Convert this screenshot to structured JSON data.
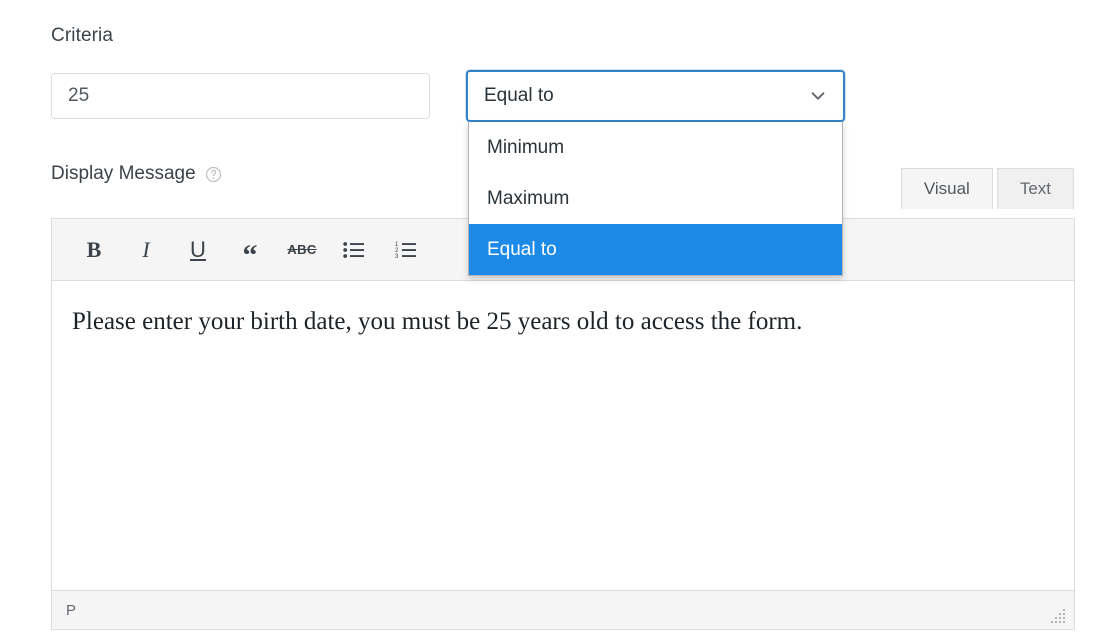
{
  "form": {
    "criteria": {
      "label": "Criteria",
      "value": "25",
      "placeholder": ""
    },
    "comparison_select": {
      "selected": "Equal to",
      "expanded": true,
      "chevron_icon": "chevron-down-icon",
      "options": [
        "Minimum",
        "Maximum",
        "Equal to"
      ]
    },
    "display_message": {
      "label": "Display Message",
      "help_icon": "question-circle-icon"
    }
  },
  "editor": {
    "tabs": [
      {
        "label": "Visual",
        "active": true
      },
      {
        "label": "Text",
        "active": false
      }
    ],
    "toolbar": [
      {
        "name": "bold-icon",
        "glyph": "B",
        "title": "Bold"
      },
      {
        "name": "italic-icon",
        "glyph": "I",
        "title": "Italic"
      },
      {
        "name": "underline-icon",
        "glyph": "U",
        "title": "Underline"
      },
      {
        "name": "blockquote-icon",
        "glyph": "“",
        "title": "Blockquote"
      },
      {
        "name": "strikethrough-icon",
        "glyph": "ABC",
        "title": "Strikethrough"
      },
      {
        "name": "unordered-list-icon",
        "glyph": "",
        "title": "Bulleted list"
      },
      {
        "name": "ordered-list-icon",
        "glyph": "",
        "title": "Numbered list"
      }
    ],
    "content": "Please enter your birth date, you must be 25 years old to access the form.",
    "status_path": "P",
    "resize_handle_icon": "resize-handle-icon"
  },
  "colors": {
    "focus_border": "#3582c4",
    "highlight": "#1e8ae8",
    "highlight_text": "#ffffff",
    "border": "#dcdcde",
    "toolbar_bg": "#f5f5f5",
    "label_text": "#3c434a"
  }
}
